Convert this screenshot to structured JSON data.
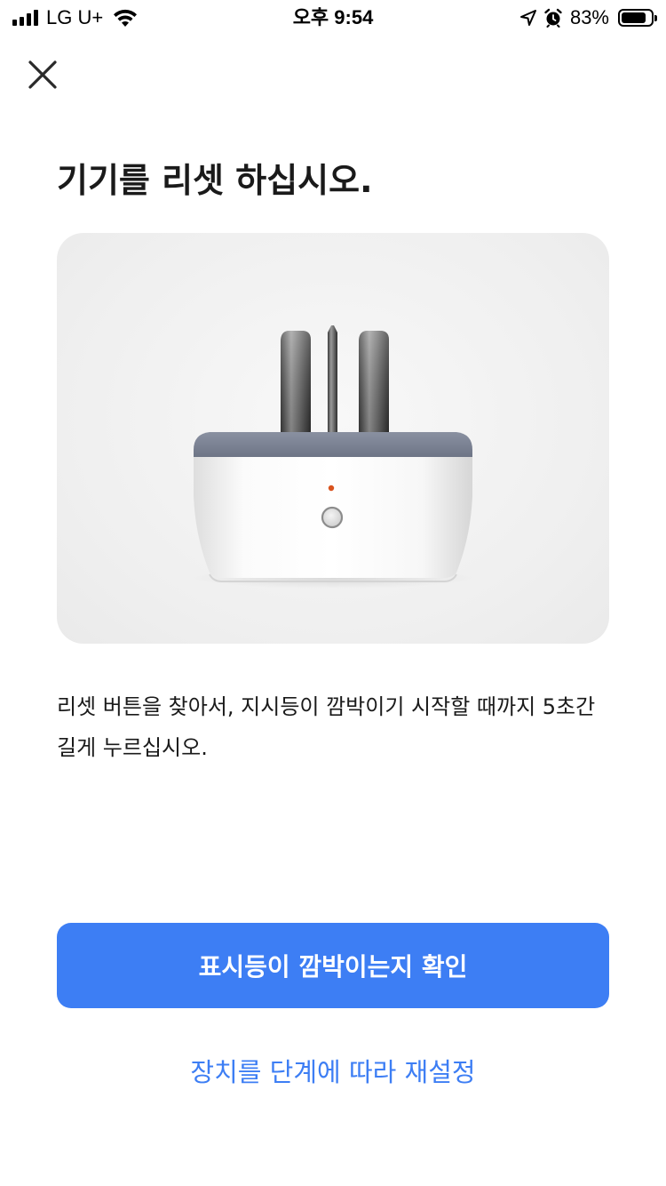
{
  "status_bar": {
    "carrier": "LG U+",
    "time": "오후 9:54",
    "battery_percent_text": "83%",
    "battery_level": 0.83,
    "icons": [
      "signal-icon",
      "wifi-icon",
      "location-arrow-icon",
      "alarm-icon",
      "battery-icon"
    ]
  },
  "header": {
    "close_icon": "close-icon"
  },
  "main": {
    "title": "기기를 리셋 하십시오.",
    "illustration": "smart-plug-device",
    "instruction": "리셋 버튼을 찾아서, 지시등이 깜박이기 시작할 때까지 5초간 길게 누르십시오."
  },
  "actions": {
    "primary_label": "표시등이 깜박이는지 확인",
    "secondary_label": "장치를 단계에 따라 재설정"
  },
  "colors": {
    "accent": "#3d7ef4",
    "indicator_led": "#d9531e",
    "plug_top": "#7c8394",
    "card_bg": "#f0f0f0"
  }
}
